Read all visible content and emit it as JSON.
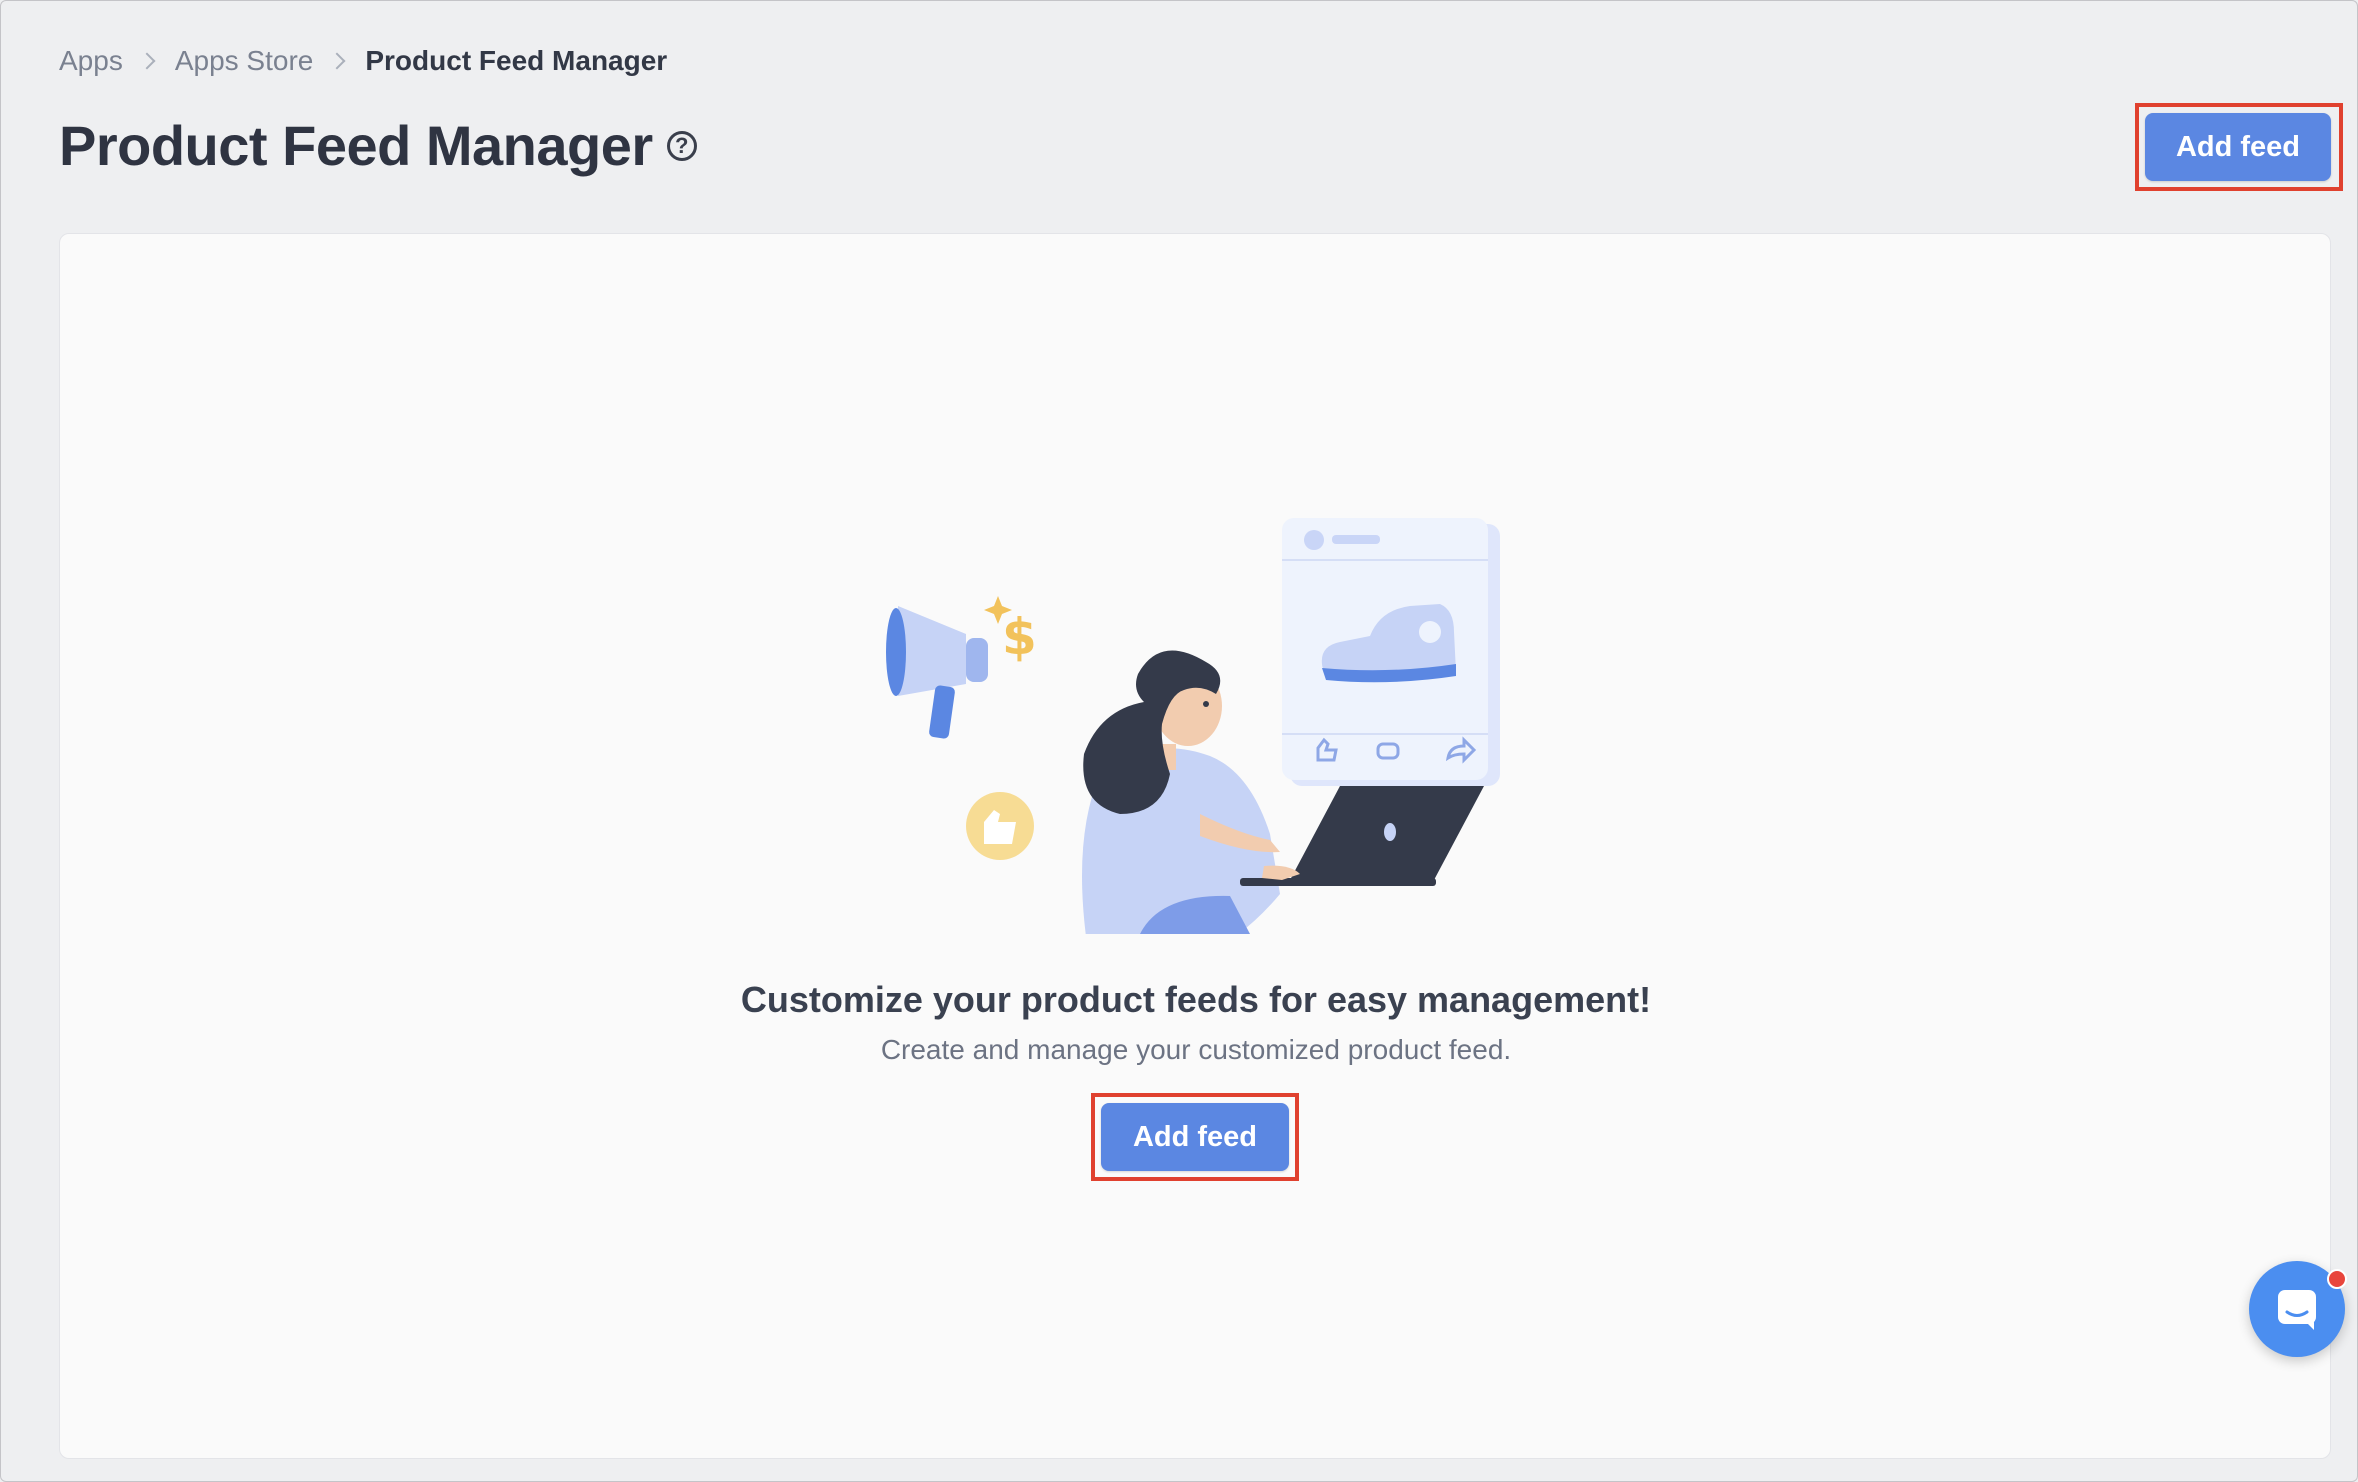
{
  "breadcrumb": {
    "items": [
      "Apps",
      "Apps Store"
    ],
    "current": "Product Feed Manager"
  },
  "header": {
    "title": "Product Feed Manager",
    "help_icon": "question-circle-icon",
    "add_button_label": "Add feed"
  },
  "empty_state": {
    "illustration": "marketing-woman-laptop-illustration",
    "title": "Customize your product feeds for easy management!",
    "subtitle": "Create and manage your customized product feed.",
    "add_button_label": "Add feed"
  },
  "chat": {
    "icon": "chat-bubble-icon",
    "has_notification": true
  },
  "colors": {
    "primary": "#5b87e2",
    "highlight": "#e0412f",
    "chat": "#4b8ef0",
    "notification": "#e8453c"
  }
}
